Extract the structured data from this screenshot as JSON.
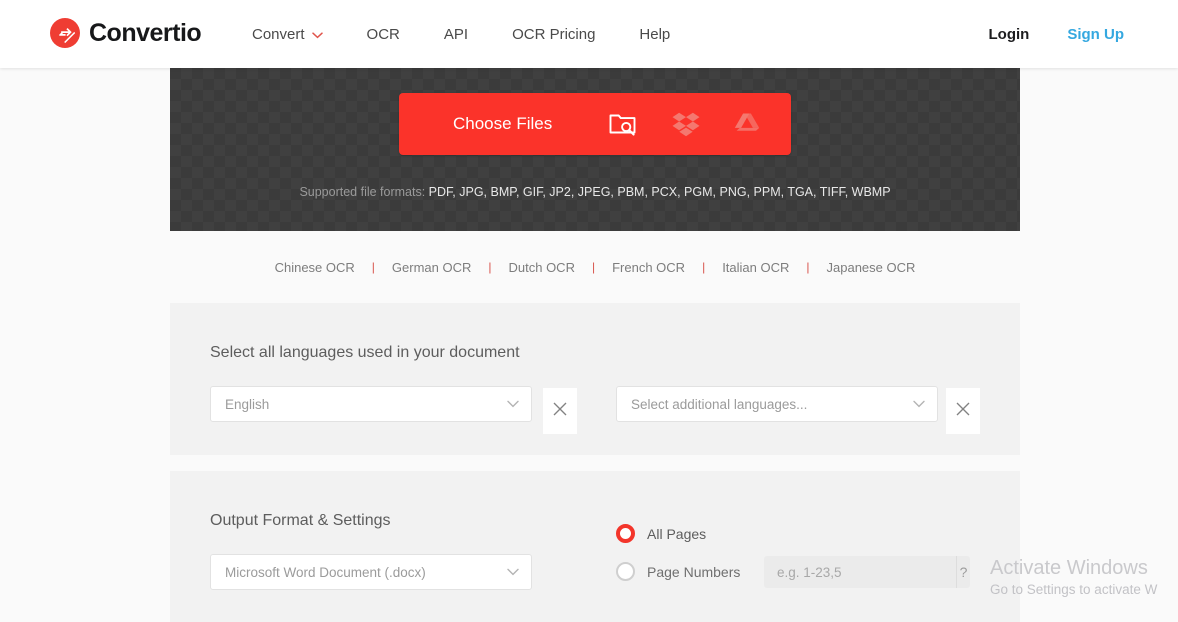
{
  "header": {
    "logo_text": "Convertio",
    "logo_icon": "convertio-circle-arrows-icon",
    "nav": [
      {
        "label": "Convert",
        "icon": "chevron-down-icon",
        "has_caret": true
      },
      {
        "label": "OCR",
        "has_caret": false
      },
      {
        "label": "API",
        "has_caret": false
      },
      {
        "label": "OCR Pricing",
        "has_caret": false
      },
      {
        "label": "Help",
        "has_caret": false
      }
    ],
    "login_label": "Login",
    "signup_label": "Sign Up",
    "signup_color": "#35a8e0"
  },
  "hero": {
    "choose_files_label": "Choose Files",
    "button_color": "#fb332a",
    "sources": [
      {
        "name": "local-files-icon",
        "title": "From Computer"
      },
      {
        "name": "dropbox-icon",
        "title": "From Dropbox"
      },
      {
        "name": "google-drive-icon",
        "title": "From Google Drive"
      }
    ],
    "formats_prefix": "Supported file formats: ",
    "formats_list": "PDF, JPG, BMP, GIF, JP2, JPEG, PBM, PCX, PGM, PNG, PPM, TGA, TIFF, WBMP"
  },
  "ocr_links": {
    "separator": "|",
    "separator_color": "#d8534b",
    "items": [
      {
        "label": "Chinese OCR"
      },
      {
        "label": "German OCR"
      },
      {
        "label": "Dutch OCR"
      },
      {
        "label": "French OCR"
      },
      {
        "label": "Italian OCR"
      },
      {
        "label": "Japanese OCR"
      }
    ]
  },
  "language_panel": {
    "title": "Select all languages used in your document",
    "primary_select": {
      "value": "English",
      "icon": "chevron-down-icon"
    },
    "additional_select": {
      "placeholder": "Select additional languages...",
      "value": "Select additional languages...",
      "icon": "chevron-down-icon"
    },
    "clear_icon": "close-icon"
  },
  "output_panel": {
    "title": "Output Format & Settings",
    "format_select": {
      "value": "Microsoft Word Document (.docx)",
      "icon": "chevron-down-icon"
    },
    "pages": {
      "all_pages_label": "All Pages",
      "all_pages_selected": true,
      "page_numbers_label": "Page Numbers",
      "page_numbers_selected": false,
      "page_numbers_placeholder": "e.g. 1-23,5",
      "page_numbers_value": "",
      "help_label": "?",
      "accent_color": "#f3352b"
    }
  },
  "watermark": {
    "title": "Activate Windows",
    "subtitle": "Go to Settings to activate W"
  }
}
